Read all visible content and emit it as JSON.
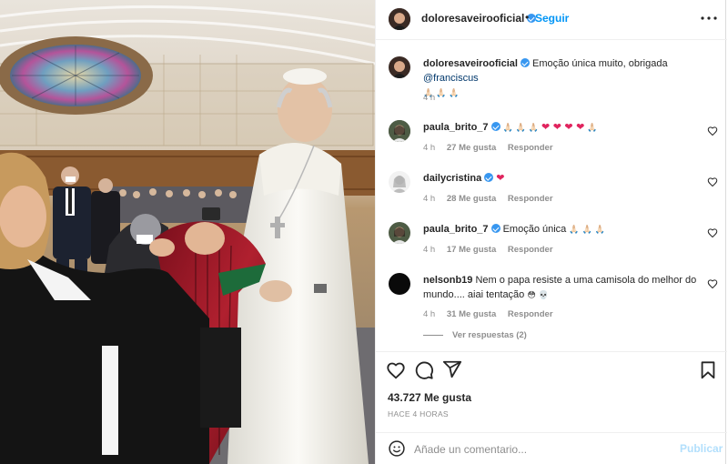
{
  "post": {
    "owner": "doloresaveirooficial",
    "follow_label": "Seguir",
    "dot": "•",
    "caption": {
      "user": "doloresaveirooficial",
      "text": "Emoção única muito, obrigada",
      "mention": "@franciscus",
      "emojis": "🙏🏻 🙏🏻 🙏🏻",
      "time": "4 h"
    },
    "comments": [
      {
        "user": "paula_brito_7",
        "verified": true,
        "text": "",
        "emojis": "🙏🏻 🙏🏻 🙏🏻",
        "hearts": "❤ ❤ ❤ ❤",
        "trail": "🙏🏻",
        "time": "4 h",
        "likes": "27 Me gusta",
        "reply": "Responder"
      },
      {
        "user": "dailycristina",
        "verified": true,
        "text": "",
        "hearts": "❤",
        "time": "4 h",
        "likes": "28 Me gusta",
        "reply": "Responder"
      },
      {
        "user": "paula_brito_7",
        "verified": true,
        "text": "Emoção única",
        "emojis": "🙏🏻 🙏🏻 🙏🏻",
        "time": "4 h",
        "likes": "17 Me gusta",
        "reply": "Responder"
      },
      {
        "user": "nelsonb19",
        "verified": false,
        "text": "Nem o papa resiste a uma camisola do melhor do mundo.... aiai tentação",
        "emojis": "😳 💀",
        "time": "4 h",
        "likes": "31 Me gusta",
        "reply": "Responder"
      }
    ],
    "view_replies": "Ver respuestas (2)",
    "like_count": "43.727 Me gusta",
    "posted": "HACE 4 HORAS",
    "comment_placeholder": "Añade un comentario...",
    "publish_label": "Publicar"
  },
  "icons": {
    "more": "more-horizontal-icon",
    "heart": "heart-outline-icon",
    "comment": "comment-bubble-icon",
    "share": "paper-plane-icon",
    "save": "bookmark-icon",
    "emoji": "smiley-face-icon"
  },
  "colors": {
    "link": "#0095f6",
    "verified": "#3897f0",
    "mention": "#00376b",
    "muted": "#8e8e8e",
    "heart_red": "#e0245e",
    "publish_disabled": "#b2dffc"
  }
}
